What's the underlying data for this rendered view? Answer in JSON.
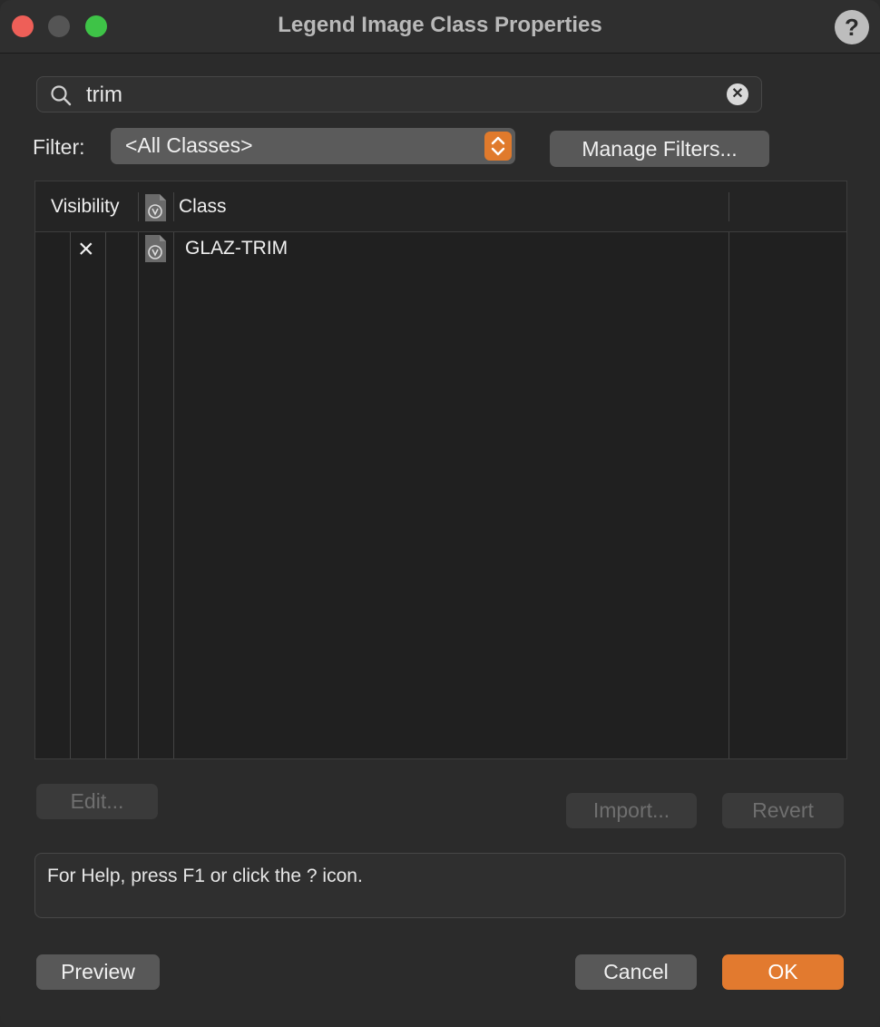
{
  "window": {
    "title": "Legend Image Class Properties",
    "help_label": "?"
  },
  "search": {
    "value": "trim"
  },
  "filter": {
    "label": "Filter:",
    "selected": "<All Classes>",
    "manage_label": "Manage Filters..."
  },
  "table": {
    "headers": {
      "visibility": "Visibility",
      "class": "Class"
    },
    "rows": [
      {
        "visible_mark": "×",
        "class": "GLAZ-TRIM"
      }
    ]
  },
  "actions": {
    "edit_label": "Edit...",
    "import_label": "Import...",
    "revert_label": "Revert"
  },
  "status": {
    "text": "For Help, press F1 or click the ? icon."
  },
  "footer": {
    "preview_label": "Preview",
    "cancel_label": "Cancel",
    "ok_label": "OK"
  },
  "colors": {
    "accent": "#e27a2f",
    "background": "#2b2b2b"
  }
}
